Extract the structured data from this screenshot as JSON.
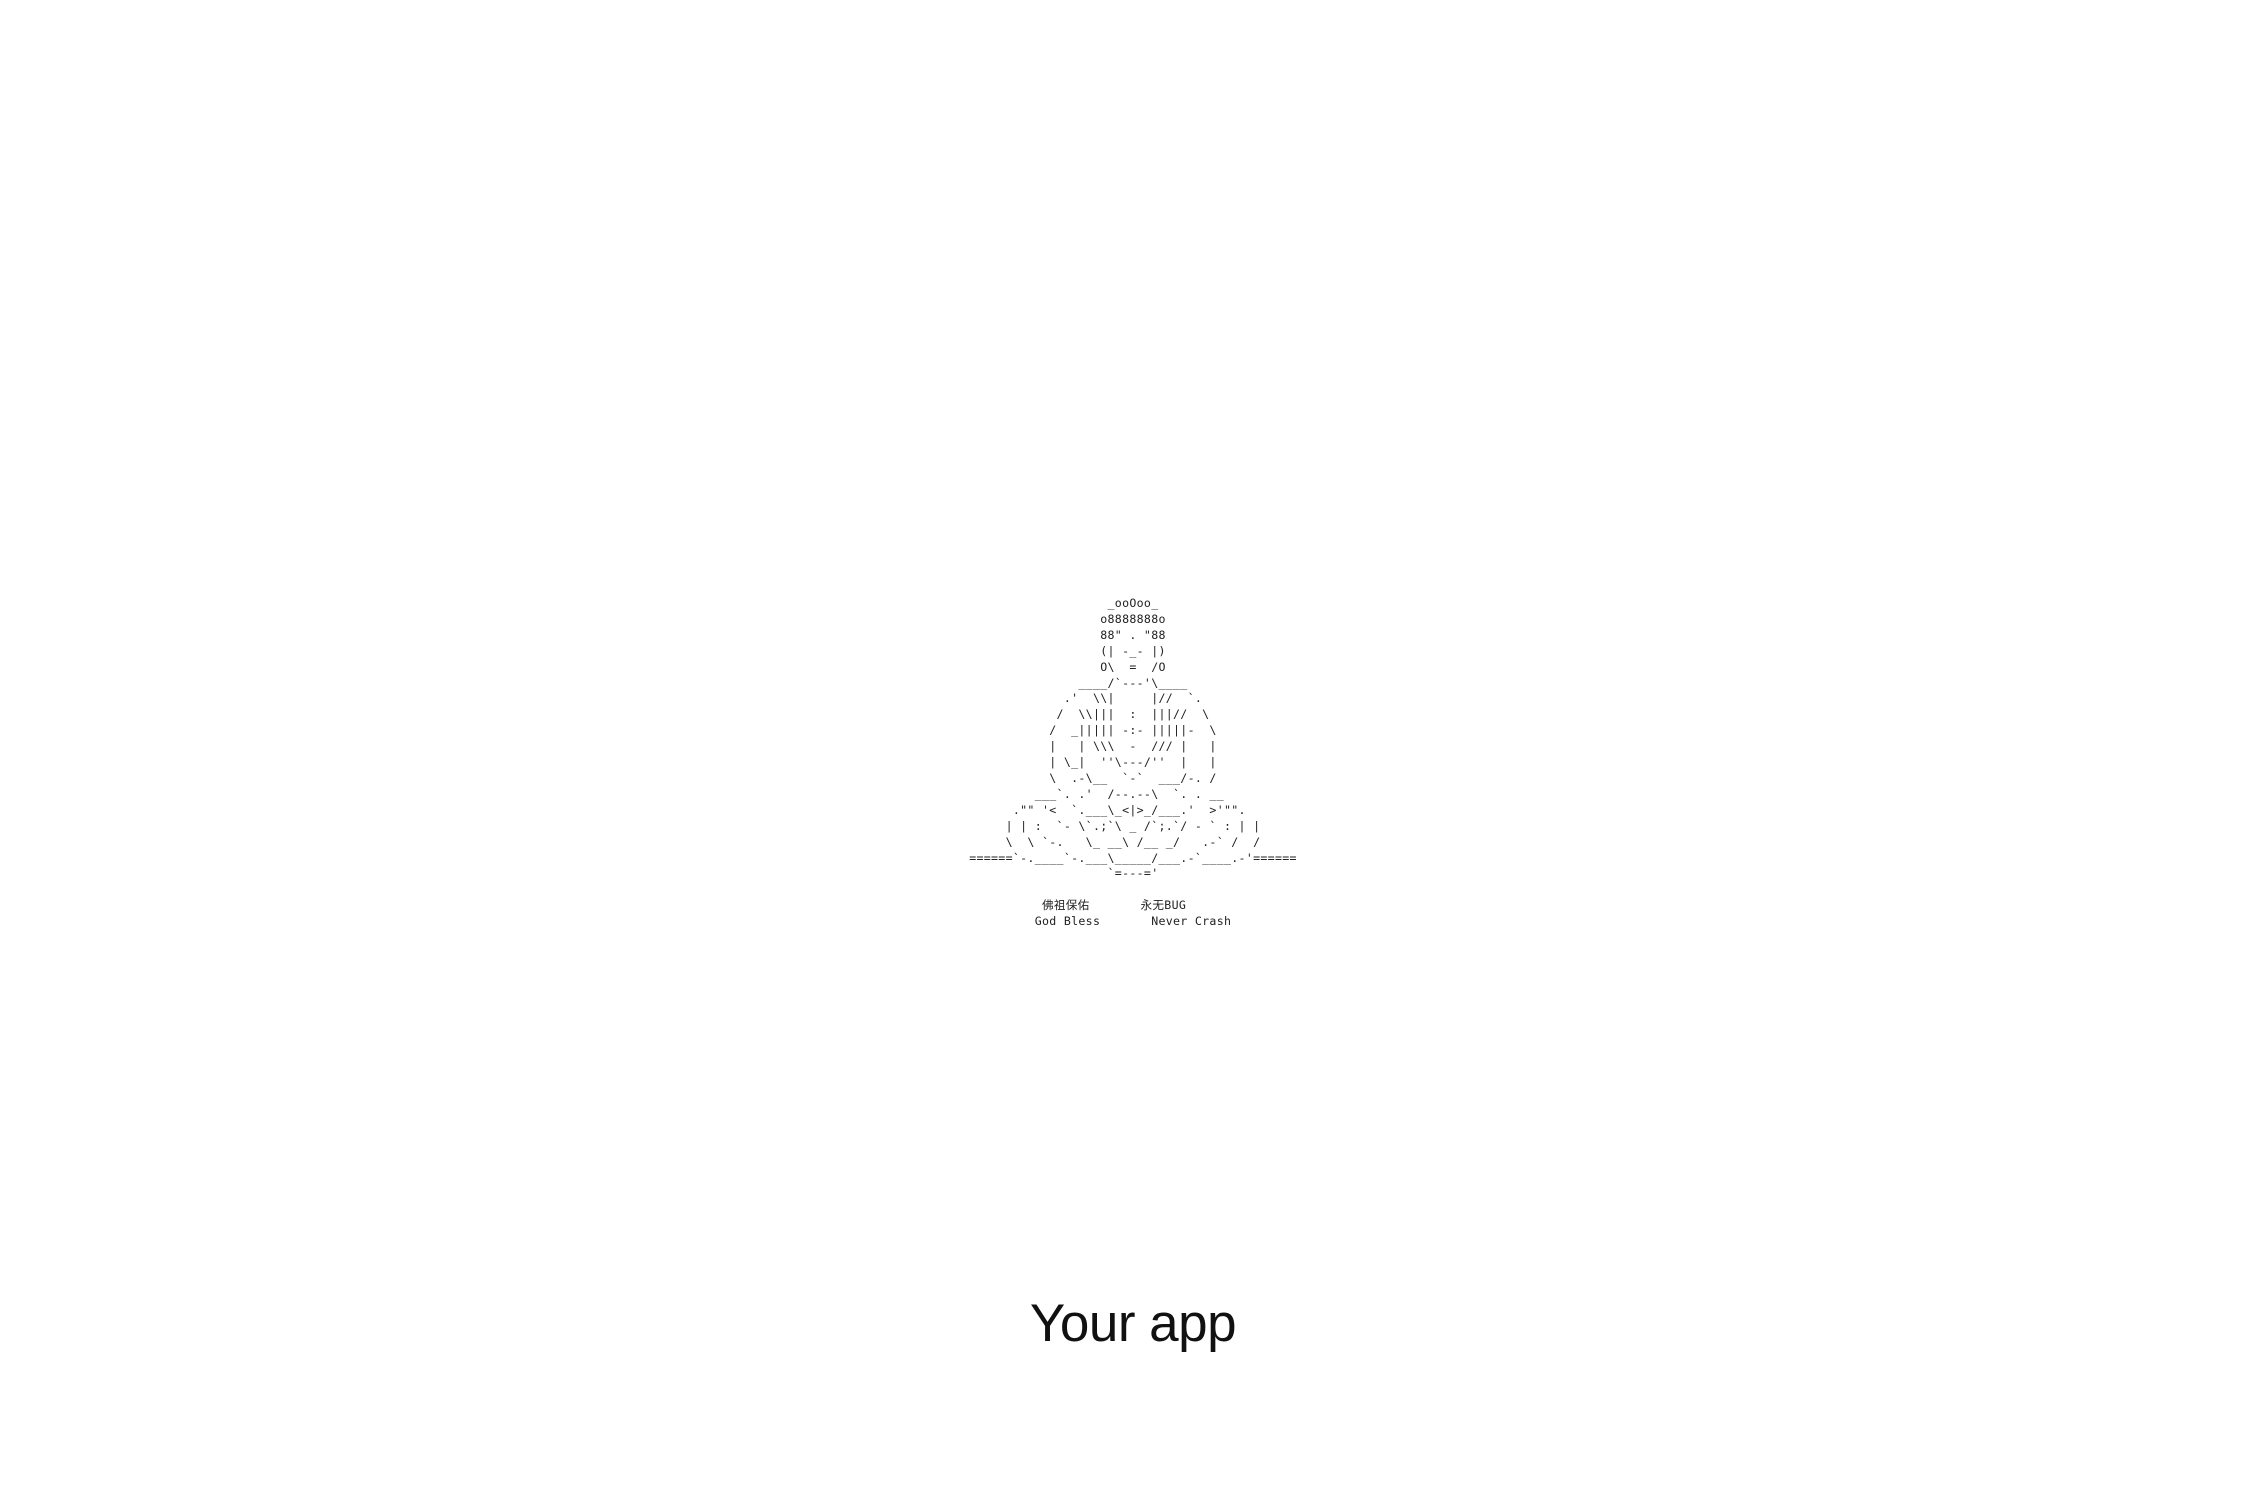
{
  "ascii_art": {
    "lines": [
      "                   _ooOoo_",
      "                  o8888888o",
      "                  88\" . \"88",
      "                  (| -_- |)",
      "                  O\\  =  /O",
      "               ____/`---'\\____",
      "             .'  \\\\|     |//  `.",
      "            /  \\\\|||  :  |||//  \\",
      "           /  _||||| -:- |||||-  \\",
      "           |   | \\\\\\  -  /// |   |",
      "           | \\_|  ''\\---/''  |   |",
      "           \\  .-\\__  `-`  ___/-. /",
      "         ___`. .'  /--.--\\  `. . __",
      "      .\"\" '<  `.___\\_<|>_/___.'  >'\"\".",
      "     | | :  `- \\`.;`\\ _ /`;.`/ - ` : | |",
      "     \\  \\ `-.   \\_ __\\ /__ _/   .-` /  /",
      "======`-.____`-.___\\_____/___.-`____.-'======",
      "                   `=---='",
      "",
      "          佛祖保佑       永无BUG",
      "         God Bless       Never Crash"
    ]
  },
  "app": {
    "title": "Your app"
  }
}
